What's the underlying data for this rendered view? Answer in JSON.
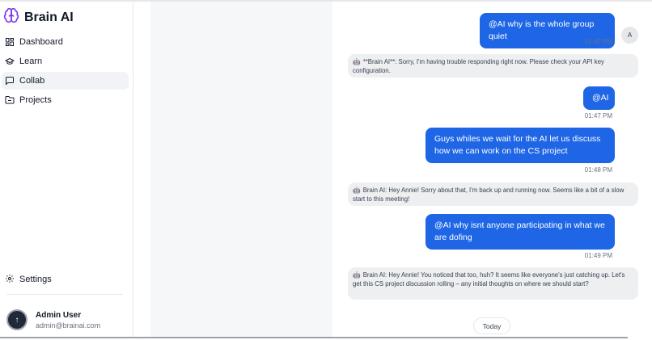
{
  "app": {
    "title": "Brain AI"
  },
  "sidebar": {
    "items": [
      {
        "label": "Dashboard",
        "icon": "grid-icon"
      },
      {
        "label": "Learn",
        "icon": "graduation-cap-icon"
      },
      {
        "label": "Collab",
        "icon": "message-square-icon",
        "active": true
      },
      {
        "label": "Projects",
        "icon": "folder-icon"
      }
    ],
    "settings_label": "Settings",
    "user": {
      "name": "Admin User",
      "email": "admin@brainai.com",
      "avatar_initial": "↑"
    }
  },
  "chat": {
    "user_avatar_initial": "A",
    "messages": [
      {
        "from": "user",
        "text": "@AI why is the whole group quiet",
        "time": "01:42 PM"
      },
      {
        "from": "ai",
        "text": "**Brain AI**: Sorry, I'm having trouble responding right now. Please check your API key configuration."
      },
      {
        "from": "user",
        "text": "@AI",
        "time": "01:47 PM"
      },
      {
        "from": "user",
        "text": "Guys whiles we wait for the AI let us discuss how we can work on the CS project",
        "time": "01:48 PM"
      },
      {
        "from": "ai",
        "text": "Brain AI: Hey Annie! Sorry about that, I'm back up and running now. Seems like a bit of a slow start to this meeting!"
      },
      {
        "from": "user",
        "text": "@AI why isnt anyone participating in what we are dofing",
        "time": "01:49 PM"
      },
      {
        "from": "ai",
        "text": "Brain AI: Hey Annie! You noticed that too, huh? It seems like everyone's just catching up. Let's get this CS project discussion rolling – any initial thoughts on where we should start?"
      }
    ],
    "date_separator": "Today"
  },
  "colors": {
    "accent": "#1e66e5",
    "brand": "#7c3aed",
    "ai_bubble": "#eeeff1",
    "active_nav": "#f1f3f6"
  }
}
